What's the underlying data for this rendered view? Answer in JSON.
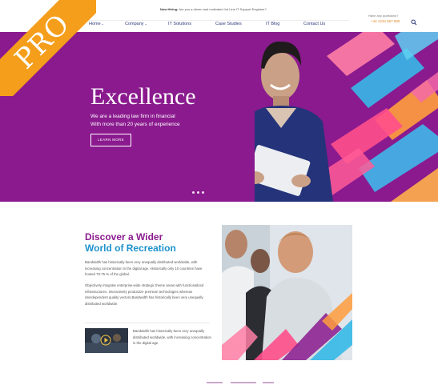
{
  "badge": {
    "label": "PRO",
    "color": "#f49e1b"
  },
  "topbar": {
    "hiring_bold": "Now Hiring:",
    "hiring_text": "Are you a driven and motivated 1st Line IT Support Engineer?",
    "questions_label": "Have any questions?",
    "phone": "+44 1234 567 890"
  },
  "nav": {
    "items": [
      {
        "label": "Home",
        "has_caret": true
      },
      {
        "label": "Company",
        "has_caret": true
      },
      {
        "label": "IT Solutions",
        "has_caret": false
      },
      {
        "label": "Case Studies",
        "has_caret": false
      },
      {
        "label": "IT Blog",
        "has_caret": false
      },
      {
        "label": "Contact Us",
        "has_caret": false
      }
    ],
    "caret_glyph": "⌄"
  },
  "hero": {
    "title": "Excellence",
    "subtitle_line1": "We are a leading law firm in financial",
    "subtitle_line2": "With more than 20 years of experience",
    "button_label": "LEARN MORE",
    "background": "#8a1a8e",
    "slides": 3,
    "active_slide": 1
  },
  "about": {
    "title_line1": "Discover a Wider",
    "title_line2": "World of Recreation",
    "paragraph1": "Bandwidth has historically been very unequally distributed worldwide, with increasing concentration in the digital age. Historically only 10 countries have hosted 70-75 % of the global.",
    "paragraph2": "Objectively integrate enterprise-wide strategic theme areas with functionalized infrastructures. Interactively productize premium technologies whereas interdependent quality vectors.Bandwidth has historically been very unequally distributed worldwide.",
    "video_caption": "Bandwidth has historically been very unequally distributed worldwide, with increasing concentration in the digital age."
  },
  "colors": {
    "purple": "#8a1a8e",
    "blue": "#1e92cc",
    "orange": "#f49e1b",
    "nav_text": "#2e3a7a"
  }
}
